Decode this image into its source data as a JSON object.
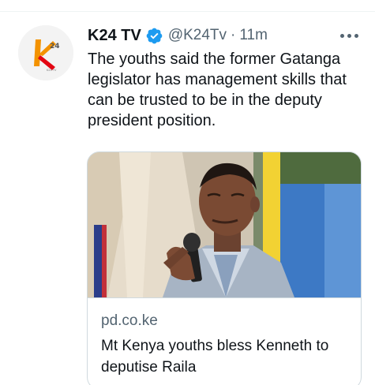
{
  "tweet": {
    "author": {
      "display_name": "K24 TV",
      "handle": "@K24Tv",
      "verified": true,
      "avatar_icon": "k24-logo-icon",
      "avatar_text": "24",
      "avatar_subtext": "K24 TV"
    },
    "separator": "·",
    "timestamp": "11m",
    "text": "The youths said the former Gatanga legislator has management skills that can be trusted to be in the deputy president position.",
    "more_icon": "more-horizontal-icon",
    "card": {
      "image_icon": "news-photo-image",
      "domain": "pd.co.ke",
      "title": "Mt Kenya youths bless Kenneth to deputise Raila"
    }
  },
  "colors": {
    "text_primary": "#0f1419",
    "text_secondary": "#536471",
    "verified_blue": "#1d9bf0",
    "border": "#cfd9de",
    "logo_orange": "#f39200",
    "logo_red": "#e30613"
  }
}
